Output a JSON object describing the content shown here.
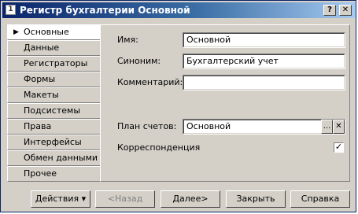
{
  "window": {
    "title": "Регистр бухгалтерии Основной",
    "icon": "1c-app-icon"
  },
  "titlebar_buttons": {
    "help": "?",
    "close": "✕"
  },
  "sidebar": {
    "items": [
      {
        "label": "Основные",
        "active": true
      },
      {
        "label": "Данные"
      },
      {
        "label": "Регистраторы"
      },
      {
        "label": "Формы"
      },
      {
        "label": "Макеты"
      },
      {
        "label": "Подсистемы"
      },
      {
        "label": "Права"
      },
      {
        "label": "Интерфейсы"
      },
      {
        "label": "Обмен данными"
      },
      {
        "label": "Прочее"
      }
    ]
  },
  "form": {
    "name_label": "Имя:",
    "name_value": "Основной",
    "synonym_label": "Синоним:",
    "synonym_value": "Бухгалтерский учет",
    "comment_label": "Комментарий:",
    "comment_value": "",
    "chart_label": "План счетов:",
    "chart_value": "Основной",
    "chart_select_glyph": "...",
    "chart_clear_glyph": "✕",
    "corr_label": "Корреспонденция",
    "corr_checked": true,
    "corr_glyph": "✓"
  },
  "buttons": {
    "actions": "Действия",
    "actions_arrow": "▾",
    "back": "<Назад",
    "next": "Далее>",
    "close": "Закрыть",
    "help": "Справка"
  }
}
